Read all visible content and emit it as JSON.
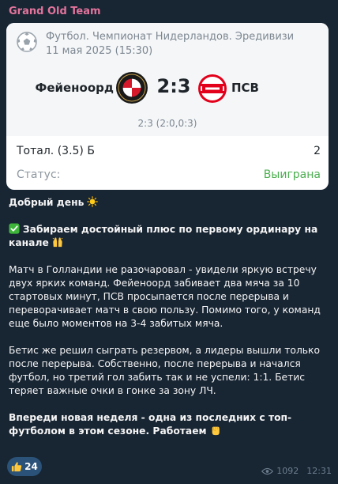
{
  "channel": {
    "name": "Grand Old Team",
    "name_color": "#e3749c"
  },
  "match": {
    "league": "Футбол. Чемпионат Нидерландов. Эредивизи",
    "datetime": "11 мая 2025 (15:30)",
    "home_team": "Фейеноорд",
    "home_logo": "feyenoord-logo-icon",
    "score": "2:3",
    "away_team": "ПСВ",
    "away_logo": "psv-logo-icon",
    "halftime": "2:3 (2:0,0:3)"
  },
  "bet": {
    "label": "Тотал. (3.5) Б",
    "odds": "2",
    "status_label": "Статус:",
    "status_value": "Выиграна",
    "status_color": "#4caf50"
  },
  "post": {
    "greeting": "Добрый день",
    "heading": "Забираем достойный плюс по первому ординару на канале",
    "p1": "Матч в Голландии не разочаровал - увидели яркую встречу двух ярких команд. Фейеноорд забивает два мяча за 10 стартовых минут, ПСВ просыпается после перерыва и переворачивает матч в свою пользу. Помимо того, у команд еще было моментов на 3-4 забитых мяча.",
    "p2": "Бетис же решил сыграть резервом, а лидеры вышли только после перерыва. Собственно, после перерыва и начался футбол, но третий гол забить так и не успели: 1:1. Бетис теряет важные очки в гонке за зону ЛЧ.",
    "p3": "Впереди новая неделя - одна из последних с топ-футболом в этом сезоне. Работаем"
  },
  "reaction": {
    "icon": "thumbs-up-icon",
    "count": "24"
  },
  "meta": {
    "views": "1092",
    "time": "12:31"
  }
}
